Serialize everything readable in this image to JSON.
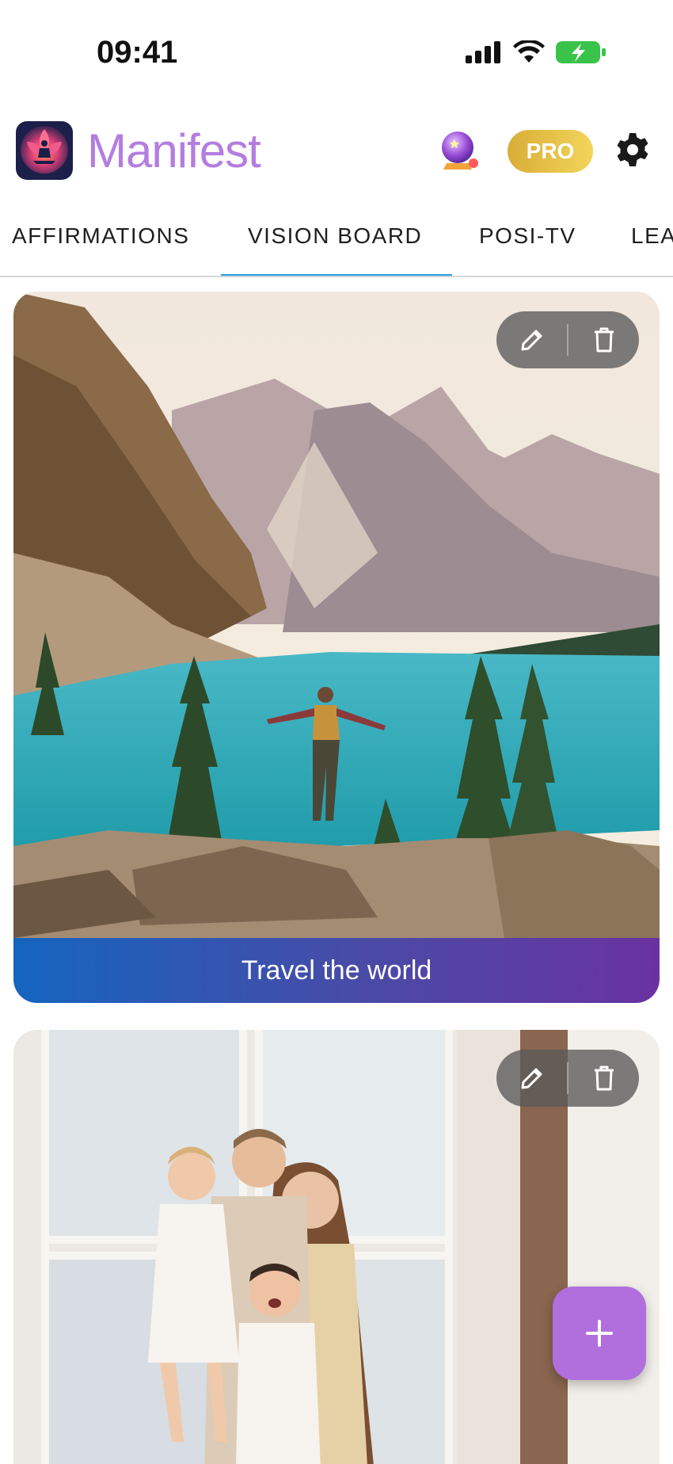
{
  "status_bar": {
    "time": "09:41",
    "icons": [
      "signal-icon",
      "wifi-icon",
      "battery-charging-icon"
    ],
    "battery_color": "#3ac34a"
  },
  "header": {
    "app_name": "Manifest",
    "app_name_color": "#b47de0",
    "pro_label": "PRO",
    "icons": [
      "app-logo-icon",
      "crystal-ball-icon",
      "gear-icon"
    ]
  },
  "tabs": {
    "items": [
      {
        "label": "AFFIRMATIONS",
        "active": false
      },
      {
        "label": "VISION BOARD",
        "active": true
      },
      {
        "label": "POSI-TV",
        "active": false
      },
      {
        "label": "LEA",
        "active": false
      }
    ],
    "active_color": "#2a9de8"
  },
  "cards": [
    {
      "caption": "Travel the world",
      "image": "mountain-lake-traveler-photo",
      "actions": [
        "pencil-icon",
        "trash-icon"
      ]
    },
    {
      "caption": "",
      "image": "family-by-window-photo",
      "actions": [
        "pencil-icon",
        "trash-icon"
      ]
    }
  ],
  "fab": {
    "icon": "plus-icon",
    "color": "#b16fdd"
  }
}
